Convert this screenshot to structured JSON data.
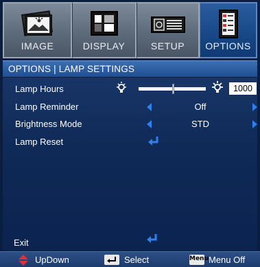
{
  "tabs": [
    {
      "label": "IMAGE",
      "icon": "image-icon",
      "active": false
    },
    {
      "label": "DISPLAY",
      "icon": "display-icon",
      "active": false
    },
    {
      "label": "SETUP",
      "icon": "setup-icon",
      "active": false
    },
    {
      "label": "OPTIONS",
      "icon": "options-icon",
      "active": true
    }
  ],
  "header": {
    "title": "OPTIONS | LAMP SETTINGS"
  },
  "rows": {
    "lamp_hours": {
      "label": "Lamp Hours",
      "value": "1000",
      "slider_fraction": 0.5
    },
    "lamp_reminder": {
      "label": "Lamp Reminder",
      "value": "Off"
    },
    "brightness_mode": {
      "label": "Brightness Mode",
      "value": "STD"
    },
    "lamp_reset": {
      "label": "Lamp Reset"
    }
  },
  "exit": {
    "label": "Exit"
  },
  "footer": {
    "updown": {
      "label": "UpDown",
      "icon": "updown-icon"
    },
    "select": {
      "label": "Select",
      "icon": "enter-key-icon"
    },
    "menu_off": {
      "label": "Menu Off",
      "key": "Menu",
      "icon": "menu-key-icon"
    }
  },
  "colors": {
    "accent_arrow": "#2f7ff0",
    "active_tab": "#174786",
    "header": "#2d5fa4",
    "panel": "#0f2a57"
  }
}
